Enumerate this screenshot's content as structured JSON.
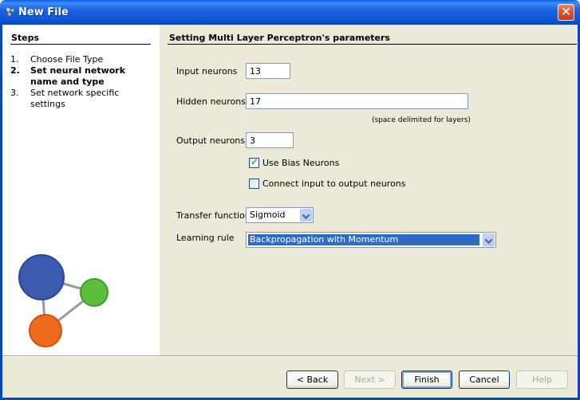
{
  "window": {
    "title": "New File",
    "close_label": "✕"
  },
  "steps": {
    "heading": "Steps",
    "items": [
      {
        "num": "1.",
        "label": "Choose File Type",
        "current": false
      },
      {
        "num": "2.",
        "label": "Set neural network name and type",
        "current": true
      },
      {
        "num": "3.",
        "label": "Set network specific settings",
        "current": false
      }
    ]
  },
  "content": {
    "heading": "Setting Multi Layer Perceptron's parameters",
    "input_neurons": {
      "label": "Input neurons",
      "value": "13"
    },
    "hidden_neurons": {
      "label": "Hidden neurons",
      "value": "17",
      "hint": "(space delimited for layers)"
    },
    "output_neurons": {
      "label": "Output neurons",
      "value": "3"
    },
    "use_bias": {
      "label": "Use Bias Neurons",
      "checked": true
    },
    "connect_io": {
      "label": "Connect input to output neurons",
      "checked": false
    },
    "transfer_function": {
      "label": "Transfer function",
      "value": "Sigmoid"
    },
    "learning_rule": {
      "label": "Learning rule",
      "value": "Backpropagation with Momentum"
    }
  },
  "buttons": {
    "back": "< Back",
    "next": "Next >",
    "finish": "Finish",
    "cancel": "Cancel",
    "help": "Help"
  },
  "colors": {
    "titlebar": "#0A5FE5",
    "selection": "#316AC5",
    "logo_blue": "#3A5BB0",
    "logo_green": "#5BBF3C",
    "logo_orange": "#F06A1E"
  }
}
